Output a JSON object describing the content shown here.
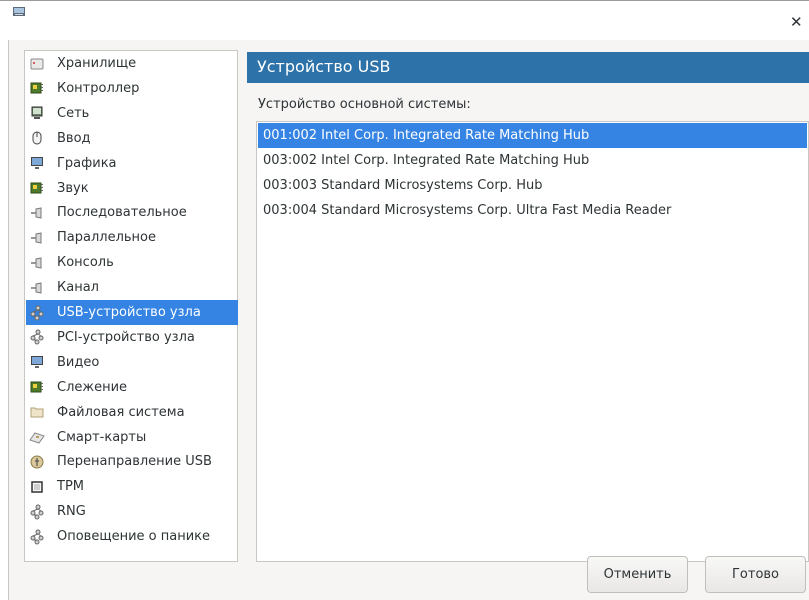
{
  "window": {
    "close_glyph": "✕"
  },
  "sidebar": {
    "items": [
      {
        "label": "Хранилище",
        "icon": "disk-icon"
      },
      {
        "label": "Контроллер",
        "icon": "chip-icon"
      },
      {
        "label": "Сеть",
        "icon": "network-icon"
      },
      {
        "label": "Ввод",
        "icon": "mouse-icon"
      },
      {
        "label": "Графика",
        "icon": "monitor-icon"
      },
      {
        "label": "Звук",
        "icon": "chip-icon"
      },
      {
        "label": "Последовательное",
        "icon": "plug-icon"
      },
      {
        "label": "Параллельное",
        "icon": "plug-icon"
      },
      {
        "label": "Консоль",
        "icon": "plug-icon"
      },
      {
        "label": "Канал",
        "icon": "plug-icon"
      },
      {
        "label": "USB-устройство узла",
        "icon": "usb-tree-icon",
        "selected": true
      },
      {
        "label": "PCI-устройство узла",
        "icon": "usb-tree-icon"
      },
      {
        "label": "Видео",
        "icon": "monitor-icon"
      },
      {
        "label": "Слежение",
        "icon": "chip-icon"
      },
      {
        "label": "Файловая система",
        "icon": "folder-icon"
      },
      {
        "label": "Смарт-карты",
        "icon": "smartcard-icon"
      },
      {
        "label": "Перенаправление USB",
        "icon": "usb-redirect-icon"
      },
      {
        "label": "TPM",
        "icon": "cpu-icon"
      },
      {
        "label": "RNG",
        "icon": "usb-tree-icon"
      },
      {
        "label": "Оповещение о панике",
        "icon": "usb-tree-icon"
      }
    ]
  },
  "main": {
    "title": "Устройство USB",
    "host_label": "Устройство основной системы:",
    "devices": [
      {
        "text": "001:002 Intel Corp. Integrated Rate Matching Hub",
        "selected": true
      },
      {
        "text": "003:002 Intel Corp. Integrated Rate Matching Hub"
      },
      {
        "text": "003:003 Standard Microsystems Corp. Hub"
      },
      {
        "text": "003:004 Standard Microsystems Corp. Ultra Fast Media Reader"
      }
    ]
  },
  "buttons": {
    "cancel": "Отменить",
    "done": "Готово"
  },
  "colors": {
    "accent": "#3584e4",
    "header": "#2d72a8"
  }
}
